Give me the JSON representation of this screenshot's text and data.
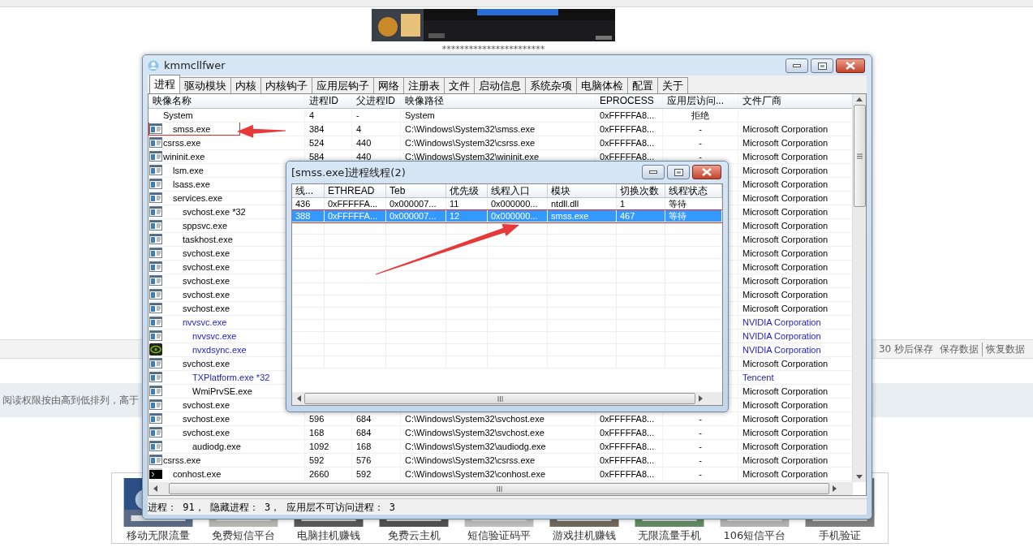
{
  "web_page": {
    "separator_text": "***********************",
    "autosave_bar": {
      "countdown": "30 秒后保存",
      "links": [
        "保存数据",
        "恢复数据"
      ]
    },
    "notice": "阅读权限按由高到低排列，高于",
    "ads": [
      {
        "caption": "移动无限流量"
      },
      {
        "caption": "免费短信平台"
      },
      {
        "caption": "电脑挂机赚钱"
      },
      {
        "caption": "免费云主机"
      },
      {
        "caption": "短信验证码平"
      },
      {
        "caption": "游戏挂机赚钱"
      },
      {
        "caption": "无限流量手机"
      },
      {
        "caption": "106短信平台"
      },
      {
        "caption": "手机验证"
      }
    ]
  },
  "window": {
    "title": "kmmcllfwer",
    "tabs": [
      {
        "label": "进程",
        "selected": true
      },
      {
        "label": "驱动模块",
        "selected": false
      },
      {
        "label": "内核",
        "selected": false
      },
      {
        "label": "内核钩子",
        "selected": false
      },
      {
        "label": "应用层钩子",
        "selected": false
      },
      {
        "label": "网络",
        "selected": false
      },
      {
        "label": "注册表",
        "selected": false
      },
      {
        "label": "文件",
        "selected": false
      },
      {
        "label": "启动信息",
        "selected": false
      },
      {
        "label": "系统杂项",
        "selected": false
      },
      {
        "label": "电脑体检",
        "selected": false
      },
      {
        "label": "配置",
        "selected": false
      },
      {
        "label": "关于",
        "selected": false
      }
    ],
    "process_table": {
      "columns": [
        "映像名称",
        "进程ID",
        "父进程ID",
        "映像路径",
        "EPROCESS",
        "应用层访问...",
        "文件厂商"
      ],
      "rows": [
        {
          "name": "System",
          "kind": "plain",
          "pid": "4",
          "ppid": "-",
          "path": "System",
          "eprocess": "0xFFFFFA8...",
          "access": "拒绝",
          "third_party": false,
          "marked": false,
          "children": [
            {
              "name": "smss.exe",
              "kind": "app",
              "pid": "384",
              "ppid": "4",
              "path": "C:\\Windows\\System32\\smss.exe",
              "eprocess": "0xFFFFFA8...",
              "access": "-",
              "vendor": "Microsoft Corporation",
              "third_party": false,
              "marked": true
            }
          ]
        },
        {
          "name": "csrss.exe",
          "kind": "app",
          "pid": "524",
          "ppid": "440",
          "path": "C:\\Windows\\System32\\csrss.exe",
          "eprocess": "0xFFFFFA8...",
          "access": "-",
          "vendor": "Microsoft Corporation",
          "third_party": false,
          "marked": false
        },
        {
          "name": "wininit.exe",
          "kind": "app",
          "pid": "584",
          "ppid": "440",
          "path": "C:\\Windows\\System32\\wininit.exe",
          "eprocess": "0xFFFFFA8...",
          "access": "-",
          "vendor": "Microsoft Corporation",
          "third_party": false,
          "marked": false,
          "children": [
            {
              "name": "lsm.exe",
              "kind": "app",
              "vendor": "Microsoft Corporation",
              "third_party": false,
              "marked": false
            },
            {
              "name": "lsass.exe",
              "kind": "app",
              "vendor": "Microsoft Corporation",
              "third_party": false,
              "marked": false
            },
            {
              "name": "services.exe",
              "kind": "app",
              "vendor": "Microsoft Corporation",
              "third_party": false,
              "marked": false,
              "children": [
                {
                  "name": "svchost.exe *32",
                  "kind": "app",
                  "vendor": "Microsoft Corporation",
                  "third_party": false,
                  "marked": false
                },
                {
                  "name": "sppsvc.exe",
                  "kind": "app",
                  "vendor": "Microsoft Corporation",
                  "third_party": false,
                  "marked": false
                },
                {
                  "name": "taskhost.exe",
                  "kind": "app",
                  "vendor": "Microsoft Corporation",
                  "third_party": false,
                  "marked": false
                },
                {
                  "name": "svchost.exe",
                  "kind": "app",
                  "vendor": "Microsoft Corporation",
                  "third_party": false,
                  "marked": false
                },
                {
                  "name": "svchost.exe",
                  "kind": "app",
                  "vendor": "Microsoft Corporation",
                  "third_party": false,
                  "marked": false
                },
                {
                  "name": "svchost.exe",
                  "kind": "app",
                  "vendor": "Microsoft Corporation",
                  "third_party": false,
                  "marked": false
                },
                {
                  "name": "svchost.exe",
                  "kind": "app",
                  "vendor": "Microsoft Corporation",
                  "third_party": false,
                  "marked": false
                },
                {
                  "name": "svchost.exe",
                  "kind": "app",
                  "vendor": "Microsoft Corporation",
                  "third_party": false,
                  "marked": false
                },
                {
                  "name": "nvvsvc.exe",
                  "kind": "app",
                  "vendor": "NVIDIA Corporation",
                  "third_party": true,
                  "marked": false,
                  "children": [
                    {
                      "name": "nvvsvc.exe",
                      "kind": "app",
                      "vendor": "NVIDIA Corporation",
                      "third_party": true,
                      "marked": false
                    },
                    {
                      "name": "nvxdsync.exe",
                      "kind": "nvidia",
                      "vendor": "NVIDIA Corporation",
                      "third_party": true,
                      "marked": false
                    }
                  ]
                },
                {
                  "name": "svchost.exe",
                  "kind": "app",
                  "vendor": "Microsoft Corporation",
                  "third_party": false,
                  "marked": false,
                  "children": [
                    {
                      "name": "TXPlatform.exe *32",
                      "kind": "app",
                      "vendor": "Tencent",
                      "third_party": true,
                      "marked": false
                    },
                    {
                      "name": "WmiPrvSE.exe",
                      "kind": "app",
                      "vendor": "Microsoft Corporation",
                      "third_party": false,
                      "marked": false
                    }
                  ]
                },
                {
                  "name": "svchost.exe",
                  "kind": "app",
                  "vendor": "Microsoft Corporation",
                  "third_party": false,
                  "marked": false
                },
                {
                  "name": "svchost.exe",
                  "kind": "app",
                  "pid": "596",
                  "ppid": "684",
                  "path": "C:\\Windows\\System32\\svchost.exe",
                  "eprocess": "0xFFFFFA8...",
                  "access": "-",
                  "vendor": "Microsoft Corporation",
                  "third_party": false,
                  "marked": false
                },
                {
                  "name": "svchost.exe",
                  "kind": "app",
                  "pid": "168",
                  "ppid": "684",
                  "path": "C:\\Windows\\System32\\svchost.exe",
                  "eprocess": "0xFFFFFA8...",
                  "access": "-",
                  "vendor": "Microsoft Corporation",
                  "third_party": false,
                  "marked": false,
                  "children": [
                    {
                      "name": "audiodg.exe",
                      "kind": "app",
                      "pid": "1092",
                      "ppid": "168",
                      "path": "C:\\Windows\\System32\\audiodg.exe",
                      "eprocess": "0xFFFFFA8...",
                      "access": "-",
                      "vendor": "Microsoft Corporation",
                      "third_party": false,
                      "marked": false
                    }
                  ]
                }
              ]
            }
          ]
        },
        {
          "name": "csrss.exe",
          "kind": "app",
          "pid": "592",
          "ppid": "576",
          "path": "C:\\Windows\\System32\\csrss.exe",
          "eprocess": "0xFFFFFA8...",
          "access": "-",
          "vendor": "Microsoft Corporation",
          "third_party": false,
          "marked": false,
          "children": [
            {
              "name": "conhost.exe",
              "kind": "console",
              "pid": "2660",
              "ppid": "592",
              "path": "C:\\Windows\\System32\\conhost.exe",
              "eprocess": "0xFFFFFA8...",
              "access": "-",
              "vendor": "Microsoft Corporation",
              "third_party": false,
              "marked": false
            }
          ]
        }
      ]
    },
    "status_bar": "进程： 91， 隐藏进程： 3， 应用层不可访问进程： 3"
  },
  "thread_dialog": {
    "title": "[smss.exe]进程线程(2)",
    "columns": [
      "线...",
      "ETHREAD",
      "Teb",
      "优先级",
      "线程入口",
      "模块",
      "切换次数",
      "线程状态"
    ],
    "rows": [
      {
        "cells": [
          "436",
          "0xFFFFFA...",
          "0x000007...",
          "11",
          "0x000000...",
          "ntdll.dll",
          "1",
          "等待"
        ],
        "selected": false,
        "marked": false
      },
      {
        "cells": [
          "388",
          "0xFFFFFA...",
          "0x000007...",
          "12",
          "0x000000...",
          "smss.exe",
          "467",
          "等待"
        ],
        "selected": true,
        "marked": true
      }
    ]
  }
}
